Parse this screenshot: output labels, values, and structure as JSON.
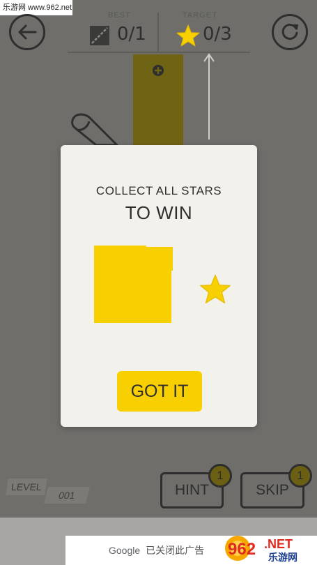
{
  "watermark": "乐游网 www.962.net",
  "header": {
    "best_label": "BEST",
    "best_value": "0/1",
    "target_label": "TARGET",
    "target_value": "0/3",
    "icons": {
      "back": "back-arrow-icon",
      "restart": "restart-icon",
      "best": "slash-square-icon",
      "target": "star-icon",
      "add": "plus-circle-icon"
    }
  },
  "modal": {
    "line1": "COLLECT ALL STARS",
    "line2": "TO WIN",
    "button_label": "GOT IT"
  },
  "footer": {
    "level_label": "LEVEL",
    "level_number": "001",
    "hint_label": "HINT",
    "hint_count": "1",
    "skip_label": "SKIP",
    "skip_count": "1"
  },
  "ad": {
    "brand": "Google",
    "message": "已关闭此广告",
    "logo_text": "962",
    "logo_suffix": ".NET",
    "logo_caption": "乐游网"
  },
  "colors": {
    "accent_yellow": "#f8cf00",
    "overlay_background": "#6f6e6b",
    "modal_background": "#f3f1ec"
  }
}
